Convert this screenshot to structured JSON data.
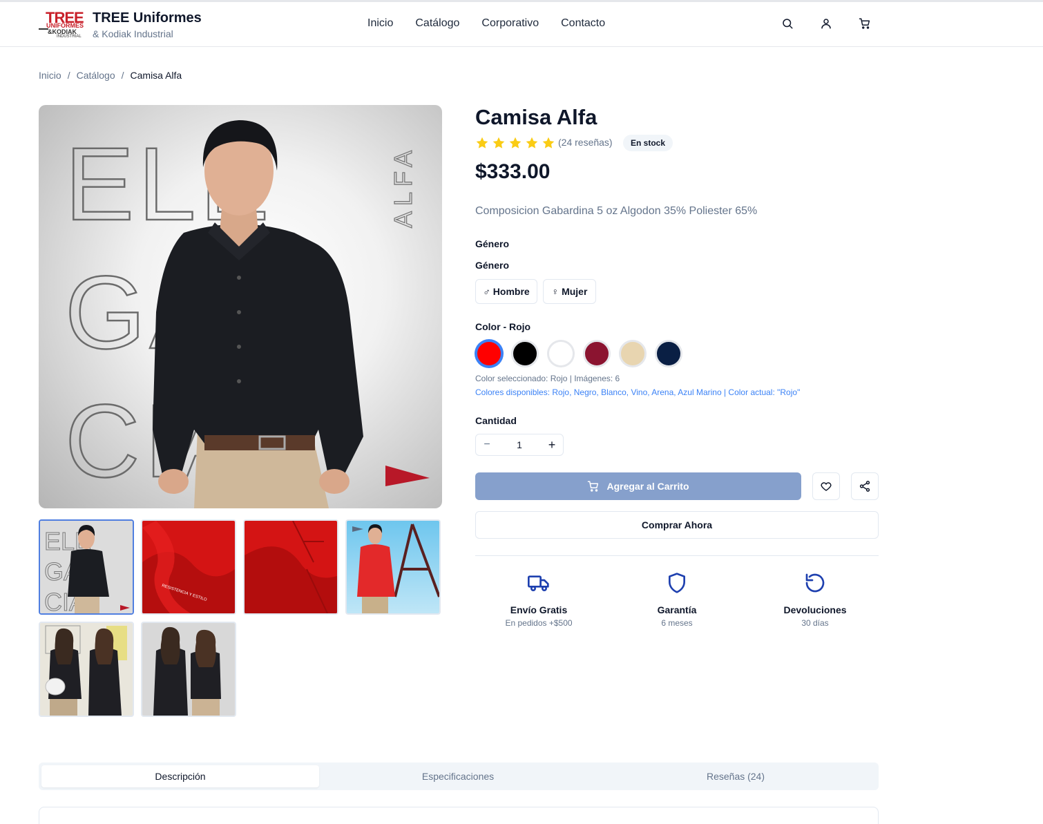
{
  "header": {
    "logo_text": [
      "TREE",
      "UNIFORMES",
      "&KODIAK",
      "INDUSTRIAL"
    ],
    "brand_title": "TREE Uniformes",
    "brand_sub": "& Kodiak Industrial",
    "nav": [
      "Inicio",
      "Catálogo",
      "Corporativo",
      "Contacto"
    ],
    "icons": [
      "search-icon",
      "user-icon",
      "cart-icon"
    ]
  },
  "breadcrumb": {
    "items": [
      "Inicio",
      "Catálogo"
    ],
    "sep": "/",
    "current": "Camisa Alfa"
  },
  "gallery": {
    "main_text": {
      "big": [
        "ELE",
        "GAN",
        "CIA"
      ],
      "vertical": "ALFA"
    },
    "thumb_text": "RESISTENCIA Y ESTILO",
    "thumbs": [
      "thumb-elegancia",
      "thumb-fabric-red",
      "thumb-fabric-pattern",
      "thumb-model-red",
      "thumb-women-1",
      "thumb-women-2"
    ]
  },
  "product": {
    "title": "Camisa Alfa",
    "rating": 5,
    "reviews": "(24 reseñas)",
    "stock": "En stock",
    "price": "$333.00",
    "description": "Composicion Gabardina 5 oz Algodon 35% Poliester 65%",
    "gender_label_1": "Género",
    "gender_label_2": "Género",
    "gender_options": [
      {
        "symbol": "♂",
        "label": "Hombre"
      },
      {
        "symbol": "♀",
        "label": "Mujer"
      }
    ],
    "color_label": "Color - Rojo",
    "colors": [
      {
        "name": "Rojo",
        "hex": "#ff0000",
        "selected": true
      },
      {
        "name": "Negro",
        "hex": "#000000",
        "selected": false
      },
      {
        "name": "Blanco",
        "hex": "#ffffff",
        "selected": false
      },
      {
        "name": "Vino",
        "hex": "#8b1430",
        "selected": false
      },
      {
        "name": "Arena",
        "hex": "#e8d5b0",
        "selected": false
      },
      {
        "name": "Azul Marino",
        "hex": "#0a1f44",
        "selected": false
      }
    ],
    "color_info": "Color seleccionado: Rojo | Imágenes: 6",
    "color_available": "Colores disponibles: Rojo, Negro, Blanco, Vino, Arena, Azul Marino | Color actual: \"Rojo\"",
    "quantity_label": "Cantidad",
    "quantity": "1",
    "qty_minus": "−",
    "qty_plus": "+",
    "add_to_cart": "Agregar al Carrito",
    "buy_now": "Comprar Ahora"
  },
  "features": [
    {
      "icon": "truck-icon",
      "title": "Envío Gratis",
      "sub": "En pedidos +$500"
    },
    {
      "icon": "shield-icon",
      "title": "Garantía",
      "sub": "6 meses"
    },
    {
      "icon": "rotate-icon",
      "title": "Devoluciones",
      "sub": "30 días"
    }
  ],
  "tabs": [
    {
      "label": "Descripción",
      "active": true
    },
    {
      "label": "Especificaciones",
      "active": false
    },
    {
      "label": "Reseñas (24)",
      "active": false
    }
  ],
  "colors": {
    "accent": "#3b82f6",
    "cart_button": "#86a0cc",
    "brand_red": "#c8202a",
    "star": "#facc15"
  }
}
